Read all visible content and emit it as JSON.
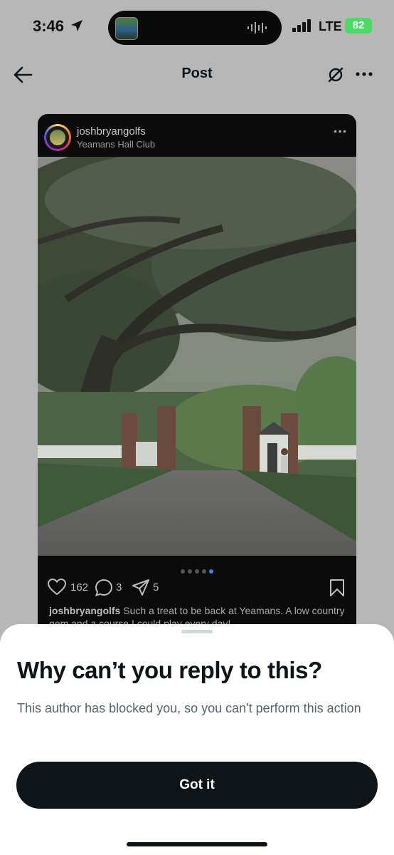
{
  "status_bar": {
    "time": "3:46",
    "network": "LTE",
    "battery": "82"
  },
  "header": {
    "title": "Post",
    "back_icon": "arrow-left-icon",
    "muted_icon": "muted-icon",
    "more_icon": "more-horizontal-icon"
  },
  "embed": {
    "username": "joshbryangolfs",
    "location": "Yeamans Hall Club",
    "likes": "162",
    "comments": "3",
    "shares": "5",
    "carousel": {
      "count": 5,
      "active": 5
    },
    "caption_user": "joshbryangolfs",
    "caption_text": "Such a treat to be back at Yeamans. A low country gem and a course I could play every day!"
  },
  "sheet": {
    "title": "Why can’t you reply to this?",
    "body": "This author has blocked you, so you can't perform this action",
    "button_label": "Got it"
  },
  "colors": {
    "overlay": "#b7b7b7",
    "button": "#0f1419",
    "body_text": "#536471",
    "active_dot": "#3d82e0"
  }
}
